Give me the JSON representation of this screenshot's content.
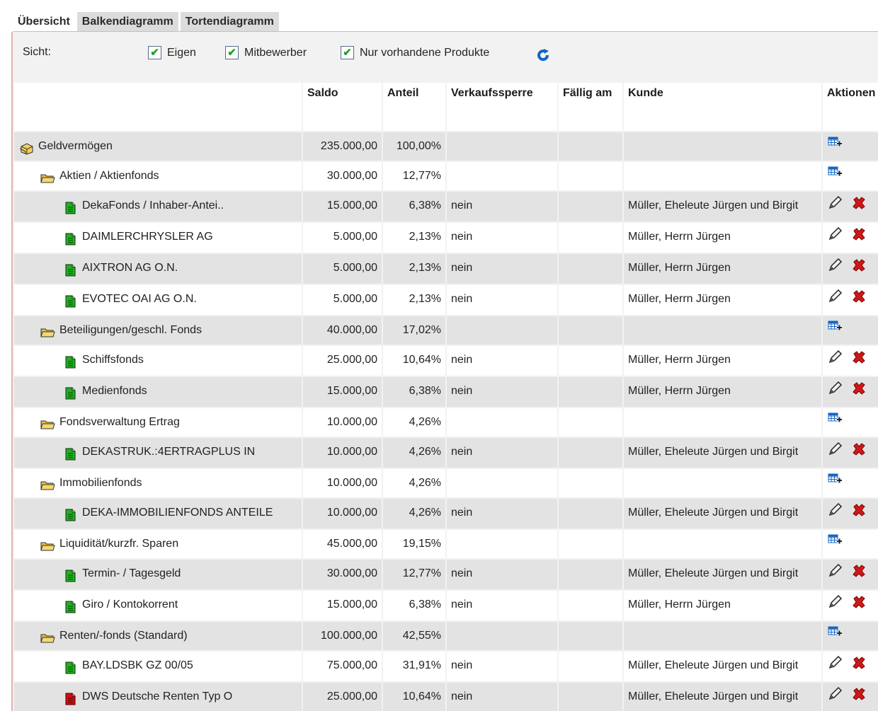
{
  "tabs": [
    "Übersicht",
    "Balkendiagramm",
    "Tortendiagramm"
  ],
  "view": {
    "label": "Sicht:",
    "options": [
      {
        "label": "Eigen",
        "checked": true
      },
      {
        "label": "Mitbewerber",
        "checked": true
      },
      {
        "label": "Nur vorhandene Produkte",
        "checked": true
      }
    ]
  },
  "columns": {
    "name": "",
    "saldo": "Saldo",
    "anteil": "Anteil",
    "sperre": "Verkaufssperre",
    "faellig": "Fällig am",
    "kunde": "Kunde",
    "aktionen": "Aktionen"
  },
  "rows": [
    {
      "level": 0,
      "icon": "stack",
      "name": "Geldvermögen",
      "saldo": "235.000,00",
      "anteil": "100,00%",
      "sperre": "",
      "faellig": "",
      "kunde": "",
      "actions": "add"
    },
    {
      "level": 1,
      "icon": "folder",
      "name": "Aktien / Aktienfonds",
      "saldo": "30.000,00",
      "anteil": "12,77%",
      "sperre": "",
      "faellig": "",
      "kunde": "",
      "actions": "add"
    },
    {
      "level": 2,
      "icon": "doc-green",
      "name": "DekaFonds / Inhaber-Antei..",
      "saldo": "15.000,00",
      "anteil": "6,38%",
      "sperre": "nein",
      "faellig": "",
      "kunde": "Müller, Eheleute Jürgen und Birgit",
      "actions": "edit"
    },
    {
      "level": 2,
      "icon": "doc-green",
      "name": "DAIMLERCHRYSLER AG",
      "saldo": "5.000,00",
      "anteil": "2,13%",
      "sperre": "nein",
      "faellig": "",
      "kunde": "Müller, Herrn Jürgen",
      "actions": "edit"
    },
    {
      "level": 2,
      "icon": "doc-green",
      "name": "AIXTRON AG O.N.",
      "saldo": "5.000,00",
      "anteil": "2,13%",
      "sperre": "nein",
      "faellig": "",
      "kunde": "Müller, Herrn Jürgen",
      "actions": "edit"
    },
    {
      "level": 2,
      "icon": "doc-green",
      "name": "EVOTEC OAI AG O.N.",
      "saldo": "5.000,00",
      "anteil": "2,13%",
      "sperre": "nein",
      "faellig": "",
      "kunde": "Müller, Herrn Jürgen",
      "actions": "edit"
    },
    {
      "level": 1,
      "icon": "folder",
      "name": "Beteiligungen/geschl. Fonds",
      "saldo": "40.000,00",
      "anteil": "17,02%",
      "sperre": "",
      "faellig": "",
      "kunde": "",
      "actions": "add"
    },
    {
      "level": 2,
      "icon": "doc-green",
      "name": "Schiffsfonds",
      "saldo": "25.000,00",
      "anteil": "10,64%",
      "sperre": "nein",
      "faellig": "",
      "kunde": "Müller, Herrn Jürgen",
      "actions": "edit"
    },
    {
      "level": 2,
      "icon": "doc-green",
      "name": "Medienfonds",
      "saldo": "15.000,00",
      "anteil": "6,38%",
      "sperre": "nein",
      "faellig": "",
      "kunde": "Müller, Herrn Jürgen",
      "actions": "edit"
    },
    {
      "level": 1,
      "icon": "folder",
      "name": "Fondsverwaltung Ertrag",
      "saldo": "10.000,00",
      "anteil": "4,26%",
      "sperre": "",
      "faellig": "",
      "kunde": "",
      "actions": "add"
    },
    {
      "level": 2,
      "icon": "doc-green",
      "name": "DEKASTRUK.:4ERTRAGPLUS IN",
      "saldo": "10.000,00",
      "anteil": "4,26%",
      "sperre": "nein",
      "faellig": "",
      "kunde": "Müller, Eheleute Jürgen und Birgit",
      "actions": "edit"
    },
    {
      "level": 1,
      "icon": "folder",
      "name": "Immobilienfonds",
      "saldo": "10.000,00",
      "anteil": "4,26%",
      "sperre": "",
      "faellig": "",
      "kunde": "",
      "actions": "add"
    },
    {
      "level": 2,
      "icon": "doc-green",
      "name": "DEKA-IMMOBILIENFONDS ANTEILE",
      "saldo": "10.000,00",
      "anteil": "4,26%",
      "sperre": "nein",
      "faellig": "",
      "kunde": "Müller, Eheleute Jürgen und Birgit",
      "actions": "edit"
    },
    {
      "level": 1,
      "icon": "folder",
      "name": "Liquidität/kurzfr. Sparen",
      "saldo": "45.000,00",
      "anteil": "19,15%",
      "sperre": "",
      "faellig": "",
      "kunde": "",
      "actions": "add"
    },
    {
      "level": 2,
      "icon": "doc-green",
      "name": "Termin- / Tagesgeld",
      "saldo": "30.000,00",
      "anteil": "12,77%",
      "sperre": "nein",
      "faellig": "",
      "kunde": "Müller, Eheleute Jürgen und Birgit",
      "actions": "edit"
    },
    {
      "level": 2,
      "icon": "doc-green",
      "name": "Giro / Kontokorrent",
      "saldo": "15.000,00",
      "anteil": "6,38%",
      "sperre": "nein",
      "faellig": "",
      "kunde": "Müller, Herrn Jürgen",
      "actions": "edit"
    },
    {
      "level": 1,
      "icon": "folder",
      "name": "Renten/-fonds (Standard)",
      "saldo": "100.000,00",
      "anteil": "42,55%",
      "sperre": "",
      "faellig": "",
      "kunde": "",
      "actions": "add"
    },
    {
      "level": 2,
      "icon": "doc-green",
      "name": "BAY.LDSBK GZ 00/05",
      "saldo": "75.000,00",
      "anteil": "31,91%",
      "sperre": "nein",
      "faellig": "",
      "kunde": "Müller, Eheleute Jürgen und Birgit",
      "actions": "edit"
    },
    {
      "level": 2,
      "icon": "doc-red",
      "name": "DWS Deutsche Renten Typ O",
      "saldo": "25.000,00",
      "anteil": "10,64%",
      "sperre": "nein",
      "faellig": "",
      "kunde": "Müller, Eheleute Jürgen und Birgit",
      "actions": "edit"
    }
  ],
  "colors": {
    "accent": "#1565c0",
    "delete": "#d01818",
    "doc_green": "#20b020",
    "doc_red": "#d01010",
    "folder": "#e8c040"
  }
}
